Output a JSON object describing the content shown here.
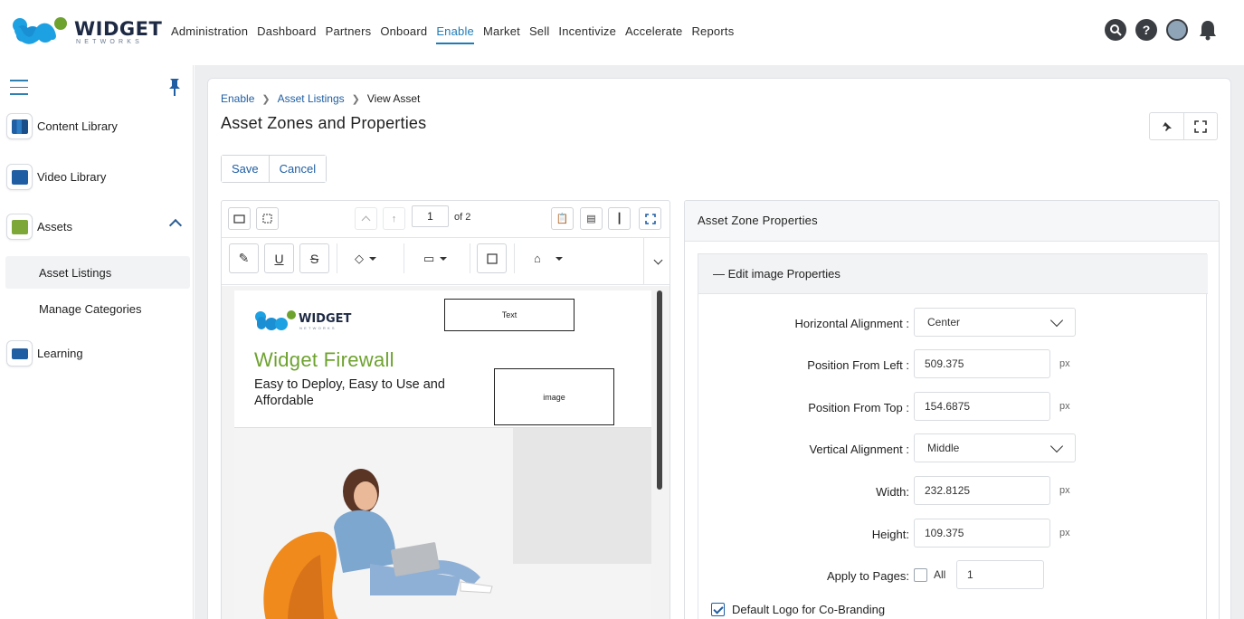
{
  "brand": {
    "name": "WIDGET",
    "tagline": "NETWORKS",
    "colors": {
      "primary": "#1f5ea3",
      "accent_green": "#6ea22f",
      "logo_blue": "#1da1e2"
    }
  },
  "nav": {
    "items": [
      "Administration",
      "Dashboard",
      "Partners",
      "Onboard",
      "Enable",
      "Market",
      "Sell",
      "Incentivize",
      "Accelerate",
      "Reports"
    ],
    "active": "Enable"
  },
  "top_icons": [
    "search-icon",
    "help-icon",
    "user-avatar",
    "bell-icon"
  ],
  "sidebar": {
    "items": [
      {
        "label": "Content Library",
        "icon": "books-icon"
      },
      {
        "label": "Video Library",
        "icon": "video-icon"
      },
      {
        "label": "Assets",
        "icon": "briefcase-icon",
        "expanded": true
      },
      {
        "label": "Learning",
        "icon": "graduation-cap-icon"
      }
    ],
    "sub_items": [
      "Asset Listings",
      "Manage Categories"
    ],
    "selected_sub": "Asset Listings"
  },
  "breadcrumb": {
    "items": [
      "Enable",
      "Asset Listings",
      "View Asset"
    ]
  },
  "page": {
    "title": "Asset Zones and Properties"
  },
  "actions": {
    "save": "Save",
    "cancel": "Cancel"
  },
  "viewer": {
    "page_current": "1",
    "page_total_label": "of 2",
    "document": {
      "brand": "WIDGET",
      "brand_sub": "NETWORKS",
      "headline": "Widget Firewall",
      "subheadline": "Easy to Deploy, Easy to Use and Affordable",
      "zone_text_label": "Text",
      "zone_image_label": "image"
    }
  },
  "properties": {
    "panel_title": "Asset Zone Properties",
    "section_title": "— Edit image Properties",
    "fields": {
      "horizontal_alignment": {
        "label": "Horizontal Alignment :",
        "value": "Center"
      },
      "position_left": {
        "label": "Position From Left :",
        "value": "509.375",
        "unit": "px"
      },
      "position_top": {
        "label": "Position From Top :",
        "value": "154.6875",
        "unit": "px"
      },
      "vertical_alignment": {
        "label": "Vertical Alignment :",
        "value": "Middle"
      },
      "width": {
        "label": "Width:",
        "value": "232.8125",
        "unit": "px"
      },
      "height": {
        "label": "Height:",
        "value": "109.375",
        "unit": "px"
      },
      "apply_pages": {
        "label": "Apply to Pages:",
        "all_label": "All",
        "all_checked": false,
        "value": "1"
      },
      "default_logo": {
        "label": "Default Logo for Co-Branding",
        "checked": true
      }
    }
  }
}
